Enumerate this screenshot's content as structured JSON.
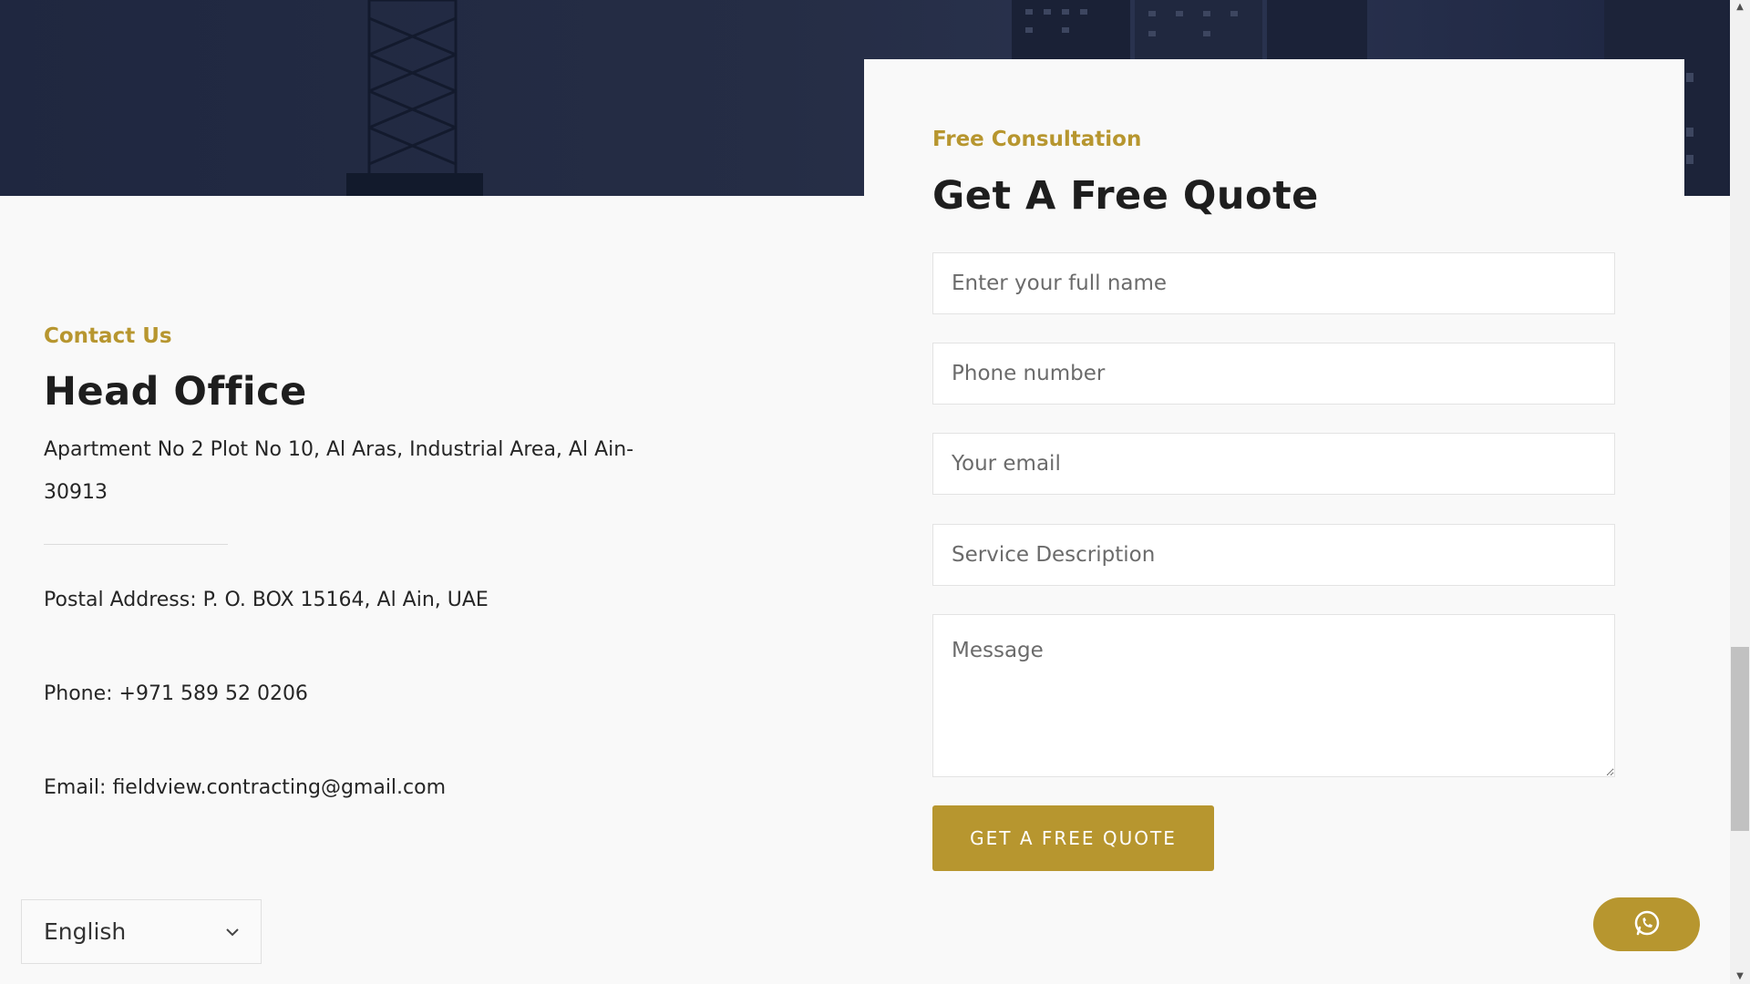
{
  "contact": {
    "eyebrow": "Contact Us",
    "title": "Head Office",
    "address": "Apartment No 2 Plot No 10, Al Aras, Industrial Area, Al Ain-30913",
    "postal": "Postal Address: P. O. BOX 15164, Al Ain, UAE",
    "phone": "Phone: +971 589 52 0206",
    "email": "Email: fieldview.contracting@gmail.com"
  },
  "quote": {
    "eyebrow": "Free Consultation",
    "title": "Get A Free Quote",
    "name_placeholder": "Enter your full name",
    "phone_placeholder": "Phone number",
    "email_placeholder": "Your email",
    "service_placeholder": "Service Description",
    "message_placeholder": "Message",
    "submit_label": "GET A FREE QUOTE"
  },
  "language": {
    "selected": "English"
  },
  "colors": {
    "accent": "#b7962f",
    "hero": "#232b44",
    "text": "#1e1e1e"
  },
  "icons": {
    "whatsapp": "whatsapp-icon",
    "language_chevron": "chevron-down-icon"
  }
}
